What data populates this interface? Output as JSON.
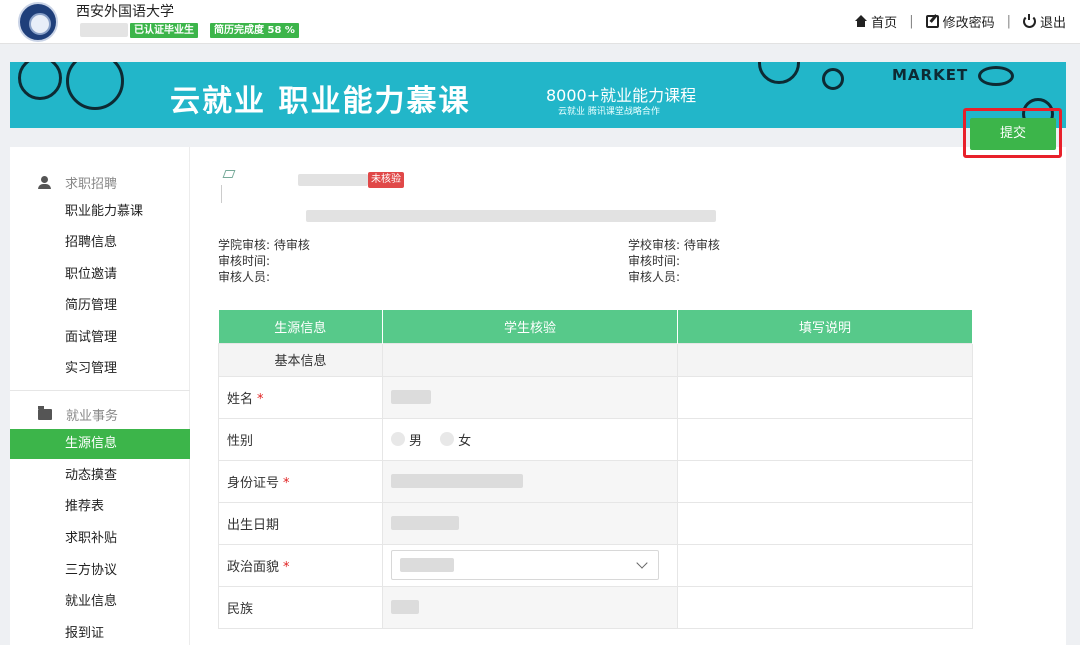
{
  "header": {
    "school_name": "西安外国语大学",
    "badge_graduate": "已认证毕业生",
    "badge_resume": "简历完成度 58 %",
    "nav": {
      "home": "首页",
      "change_password": "修改密码",
      "logout": "退出"
    }
  },
  "banner": {
    "title": "云就业  职业能力慕课",
    "subtitle": "8000+就业能力课程",
    "subtitle_small": "云就业 腾讯课堂战略合作",
    "market_text": "MARKET"
  },
  "sidebar": {
    "group1": {
      "label": "求职招聘",
      "icon": "person-icon",
      "items": [
        "职业能力慕课",
        "招聘信息",
        "职位邀请",
        "简历管理",
        "面试管理",
        "实习管理"
      ]
    },
    "group2": {
      "label": "就业事务",
      "icon": "folder-icon",
      "items": [
        "生源信息",
        "动态摸查",
        "推荐表",
        "求职补贴",
        "三方协议",
        "就业信息",
        "报到证"
      ],
      "active": "生源信息"
    }
  },
  "profile": {
    "status_tag": "未核验"
  },
  "audit": {
    "college": {
      "status": "学院审核: 待审核",
      "time": "审核时间:",
      "person": "审核人员:"
    },
    "school": {
      "status": "学校审核: 待审核",
      "time": "审核时间:",
      "person": "审核人员:"
    }
  },
  "submit_label": "提交",
  "table": {
    "headers": [
      "生源信息",
      "学生核验",
      "填写说明"
    ],
    "section": "基本信息",
    "rows": [
      {
        "label": "姓名",
        "required": true
      },
      {
        "label": "性别",
        "required": false,
        "options": [
          "男",
          "女"
        ]
      },
      {
        "label": "身份证号",
        "required": true
      },
      {
        "label": "出生日期",
        "required": false
      },
      {
        "label": "政治面貌",
        "required": true
      },
      {
        "label": "民族",
        "required": false
      }
    ]
  },
  "colors": {
    "accent": "#3cb54a",
    "table_header": "#57c98a",
    "banner": "#22b6c9",
    "highlight": "#e8202a"
  }
}
